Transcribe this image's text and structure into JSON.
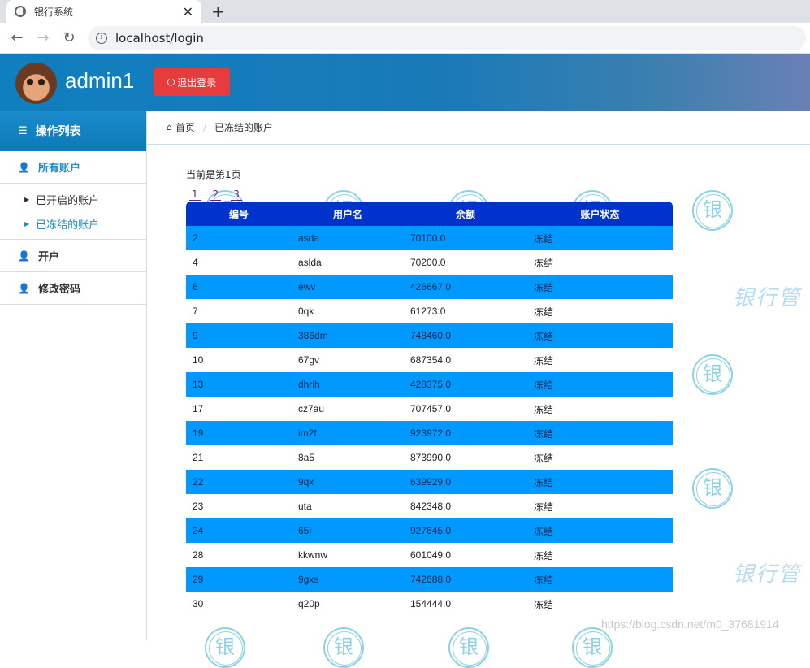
{
  "browser": {
    "tab_title": "银行系统",
    "close_glyph": "✕",
    "new_tab_glyph": "+",
    "url": "localhost/login"
  },
  "header": {
    "username": "admin1",
    "logout_label": "退出登录",
    "colors": {
      "logout": "#e83b3b",
      "header_start": "#0f7fbf",
      "header_end": "#6a80b4"
    }
  },
  "sidebar": {
    "title": "操作列表",
    "items": [
      {
        "label": "所有账户"
      },
      {
        "label": "已开启的账户"
      },
      {
        "label": "已冻结的账户"
      },
      {
        "label": "开户"
      },
      {
        "label": "修改密码"
      }
    ]
  },
  "breadcrumb": {
    "home": "首页",
    "current": "已冻结的账户"
  },
  "main": {
    "page_info": "当前是第1页",
    "pages": [
      "1",
      "2",
      "3"
    ],
    "columns": [
      "编号",
      "用户名",
      "余额",
      "账户状态"
    ],
    "rows": [
      [
        "2",
        "asda",
        "70100.0",
        "冻结"
      ],
      [
        "4",
        "aslda",
        "70200.0",
        "冻结"
      ],
      [
        "6",
        "ewv",
        "426667.0",
        "冻结"
      ],
      [
        "7",
        "0qk",
        "61273.0",
        "冻结"
      ],
      [
        "9",
        "386dm",
        "748460.0",
        "冻结"
      ],
      [
        "10",
        "67gv",
        "687354.0",
        "冻结"
      ],
      [
        "13",
        "dhrih",
        "428375.0",
        "冻结"
      ],
      [
        "17",
        "cz7au",
        "707457.0",
        "冻结"
      ],
      [
        "19",
        "im2f",
        "923972.0",
        "冻结"
      ],
      [
        "21",
        "8a5",
        "873990.0",
        "冻结"
      ],
      [
        "22",
        "9qx",
        "639929.0",
        "冻结"
      ],
      [
        "23",
        "uta",
        "842348.0",
        "冻结"
      ],
      [
        "24",
        "65l",
        "927645.0",
        "冻结"
      ],
      [
        "28",
        "kkwnw",
        "601049.0",
        "冻结"
      ],
      [
        "29",
        "9gxs",
        "742688.0",
        "冻结"
      ],
      [
        "30",
        "q20p",
        "154444.0",
        "冻结"
      ]
    ],
    "colors": {
      "table_header": "#0033cc",
      "row_highlight": "#0099ff"
    }
  },
  "watermark": {
    "stamp_char": "银",
    "text": "银行管",
    "footer_url": "https://blog.csdn.net/m0_37681914"
  }
}
